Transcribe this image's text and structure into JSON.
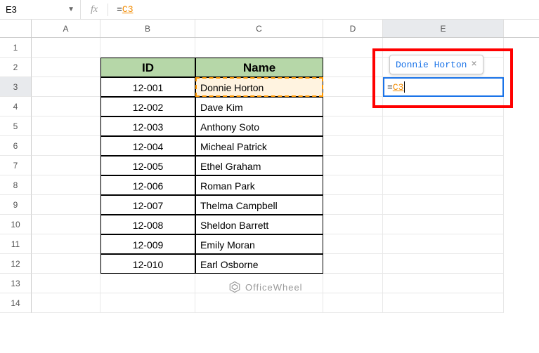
{
  "activeCell": "E3",
  "formulaBar": {
    "fx": "fx",
    "prefix": "=",
    "ref": "C3"
  },
  "columns": [
    "A",
    "B",
    "C",
    "D",
    "E"
  ],
  "rows": [
    1,
    2,
    3,
    4,
    5,
    6,
    7,
    8,
    9,
    10,
    11,
    12,
    13,
    14
  ],
  "highlightRow": 3,
  "table": {
    "headers": {
      "id": "ID",
      "name": "Name"
    },
    "rows": [
      {
        "id": "12-001",
        "name": "Donnie Horton"
      },
      {
        "id": "12-002",
        "name": "Dave Kim"
      },
      {
        "id": "12-003",
        "name": "Anthony Soto"
      },
      {
        "id": "12-004",
        "name": "Micheal Patrick"
      },
      {
        "id": "12-005",
        "name": "Ethel Graham"
      },
      {
        "id": "12-006",
        "name": "Roman Park"
      },
      {
        "id": "12-007",
        "name": "Thelma Campbell"
      },
      {
        "id": "12-008",
        "name": "Sheldon Barrett"
      },
      {
        "id": "12-009",
        "name": "Emily Moran"
      },
      {
        "id": "12-010",
        "name": "Earl Osborne"
      }
    ]
  },
  "tooltip": {
    "text": "Donnie Horton",
    "close": "×"
  },
  "editingCell": {
    "prefix": "=",
    "ref": "C3"
  },
  "watermark": "OfficeWheel",
  "chart_data": {
    "type": "table",
    "title": "",
    "columns": [
      "ID",
      "Name"
    ],
    "rows": [
      [
        "12-001",
        "Donnie Horton"
      ],
      [
        "12-002",
        "Dave Kim"
      ],
      [
        "12-003",
        "Anthony Soto"
      ],
      [
        "12-004",
        "Micheal Patrick"
      ],
      [
        "12-005",
        "Ethel Graham"
      ],
      [
        "12-006",
        "Roman Park"
      ],
      [
        "12-007",
        "Thelma Campbell"
      ],
      [
        "12-008",
        "Sheldon Barrett"
      ],
      [
        "12-009",
        "Emily Moran"
      ],
      [
        "12-010",
        "Earl Osborne"
      ]
    ]
  }
}
